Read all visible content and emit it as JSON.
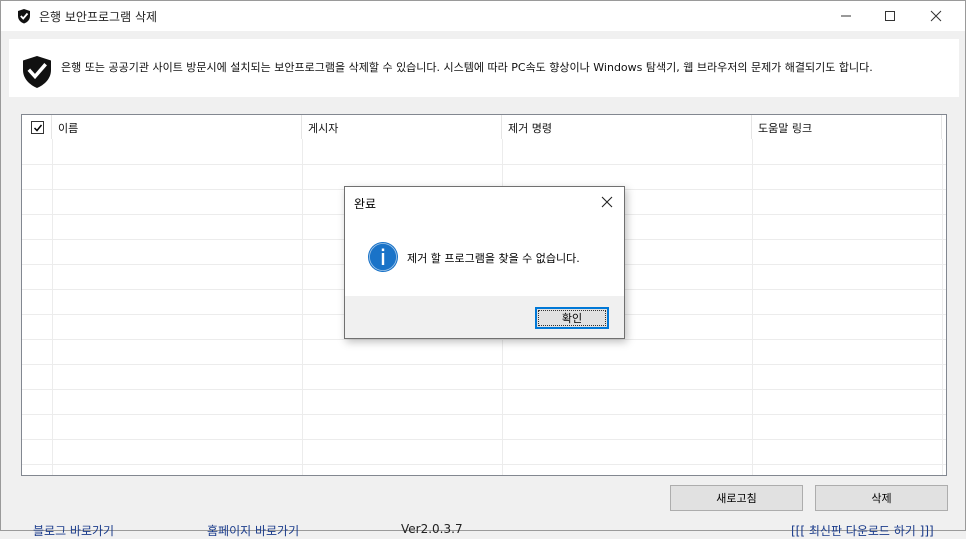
{
  "window": {
    "title": "은행 보안프로그램 삭제",
    "icon": "shield-check-icon"
  },
  "banner": {
    "text": "은행 또는 공공기관 사이트 방문시에 설치되는 보안프로그램을 삭제할 수 있습니다. 시스템에 따라 PC속도 향상이나 Windows 탐색기, 웹 브라우저의 문제가 해결되기도 합니다."
  },
  "list": {
    "select_all_checked": true,
    "columns": [
      "이름",
      "게시자",
      "제거 명령",
      "도움말 링크"
    ],
    "rows": []
  },
  "buttons": {
    "refresh_label": "새로고침",
    "delete_label": "삭제"
  },
  "footer": {
    "blog_link": "블로그 바로가기",
    "homepage_link": "홈페이지 바로가기",
    "version": "Ver2.0.3.7",
    "download_link": "[[[ 최신판 다운로드 하기 ]]]"
  },
  "dialog": {
    "title": "완료",
    "message": "제거 할 프로그램을 찾을 수 없습니다.",
    "ok_label": "확인",
    "icon": "info-icon"
  },
  "colors": {
    "accent": "#0078d7",
    "info_icon": "#1a73c8",
    "link": "#1c3d8c"
  }
}
